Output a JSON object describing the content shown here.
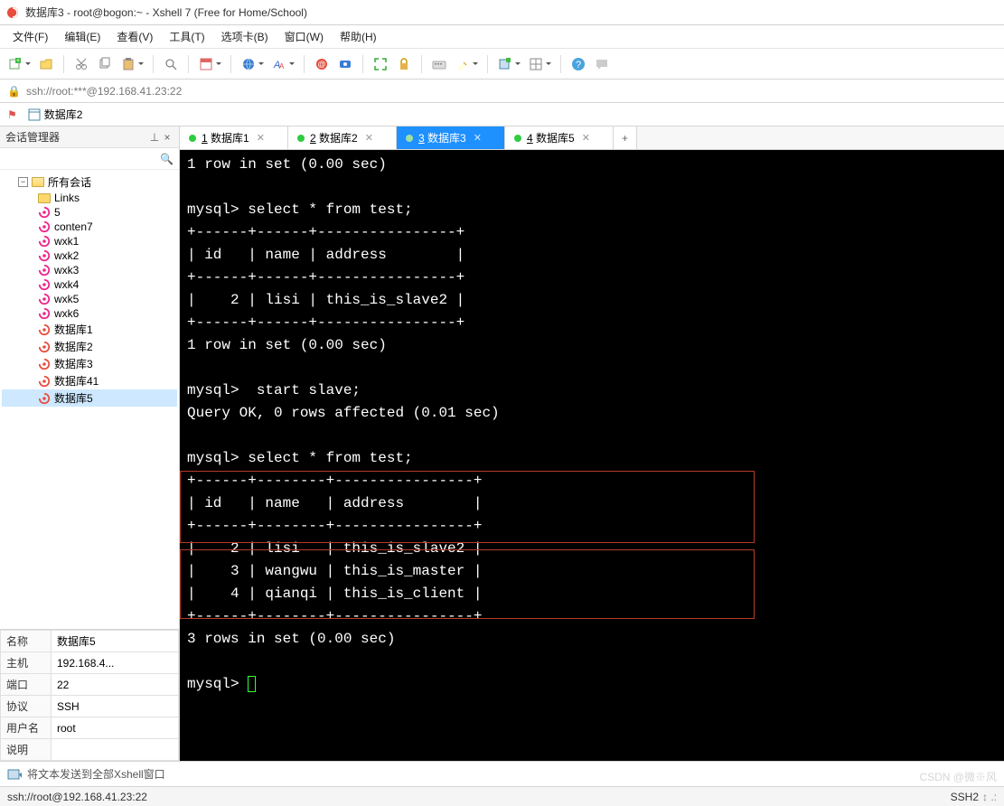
{
  "window": {
    "title": "数据库3 - root@bogon:~ - Xshell 7 (Free for Home/School)"
  },
  "menubar": [
    {
      "label": "文件(F)"
    },
    {
      "label": "编辑(E)"
    },
    {
      "label": "查看(V)"
    },
    {
      "label": "工具(T)"
    },
    {
      "label": "选项卡(B)"
    },
    {
      "label": "窗口(W)"
    },
    {
      "label": "帮助(H)"
    }
  ],
  "address": {
    "text": "ssh://root:***@192.168.41.23:22"
  },
  "bookmarks": [
    {
      "label": "数据库2"
    }
  ],
  "sidebar": {
    "title": "会话管理器",
    "pin_glyph": "⊥",
    "close_glyph": "×",
    "search_glyph": "🔍",
    "root": "所有会话",
    "items": [
      {
        "label": "Links",
        "type": "folder"
      },
      {
        "label": "5",
        "type": "session"
      },
      {
        "label": "conten7",
        "type": "session"
      },
      {
        "label": "wxk1",
        "type": "session"
      },
      {
        "label": "wxk2",
        "type": "session"
      },
      {
        "label": "wxk3",
        "type": "session"
      },
      {
        "label": "wxk4",
        "type": "session"
      },
      {
        "label": "wxk5",
        "type": "session"
      },
      {
        "label": "wxk6",
        "type": "session"
      },
      {
        "label": "数据库1",
        "type": "session-active"
      },
      {
        "label": "数据库2",
        "type": "session-active"
      },
      {
        "label": "数据库3",
        "type": "session-active"
      },
      {
        "label": "数据库41",
        "type": "session-active"
      },
      {
        "label": "数据库5",
        "type": "session-active",
        "selected": true
      }
    ],
    "props": {
      "名称": "数据库5",
      "主机": "192.168.4...",
      "端口": "22",
      "协议": "SSH",
      "用户名": "root",
      "说明": ""
    }
  },
  "tabs": [
    {
      "num": "1",
      "label": "数据库1",
      "active": false
    },
    {
      "num": "2",
      "label": "数据库2",
      "active": false
    },
    {
      "num": "3",
      "label": "数据库3",
      "active": true
    },
    {
      "num": "4",
      "label": "数据库5",
      "active": false
    }
  ],
  "tab_add": "+",
  "terminal_lines": [
    "1 row in set (0.00 sec)",
    "",
    "mysql> select * from test;",
    "+------+------+----------------+",
    "| id   | name | address        |",
    "+------+------+----------------+",
    "|    2 | lisi | this_is_slave2 |",
    "+------+------+----------------+",
    "1 row in set (0.00 sec)",
    "",
    "mysql>  start slave;",
    "Query OK, 0 rows affected (0.01 sec)",
    "",
    "mysql> select * from test;",
    "+------+--------+----------------+",
    "| id   | name   | address        |",
    "+------+--------+----------------+",
    "|    2 | lisi   | this_is_slave2 |",
    "|    3 | wangwu | this_is_master |",
    "|    4 | qianqi | this_is_client |",
    "+------+--------+----------------+",
    "3 rows in set (0.00 sec)",
    "",
    "mysql> "
  ],
  "bottombar": {
    "label": "将文本发送到全部Xshell窗口"
  },
  "statusbar": {
    "left": "ssh://root@192.168.41.23:22",
    "right": "SSH2",
    "corner": "↕ .:"
  },
  "watermark": "CSDN @微※风",
  "icons": {
    "app": "◆",
    "lock": "🔒",
    "flag": "⚑",
    "file": "▤",
    "link": "🔗",
    "help": "?",
    "chat": "💬"
  }
}
